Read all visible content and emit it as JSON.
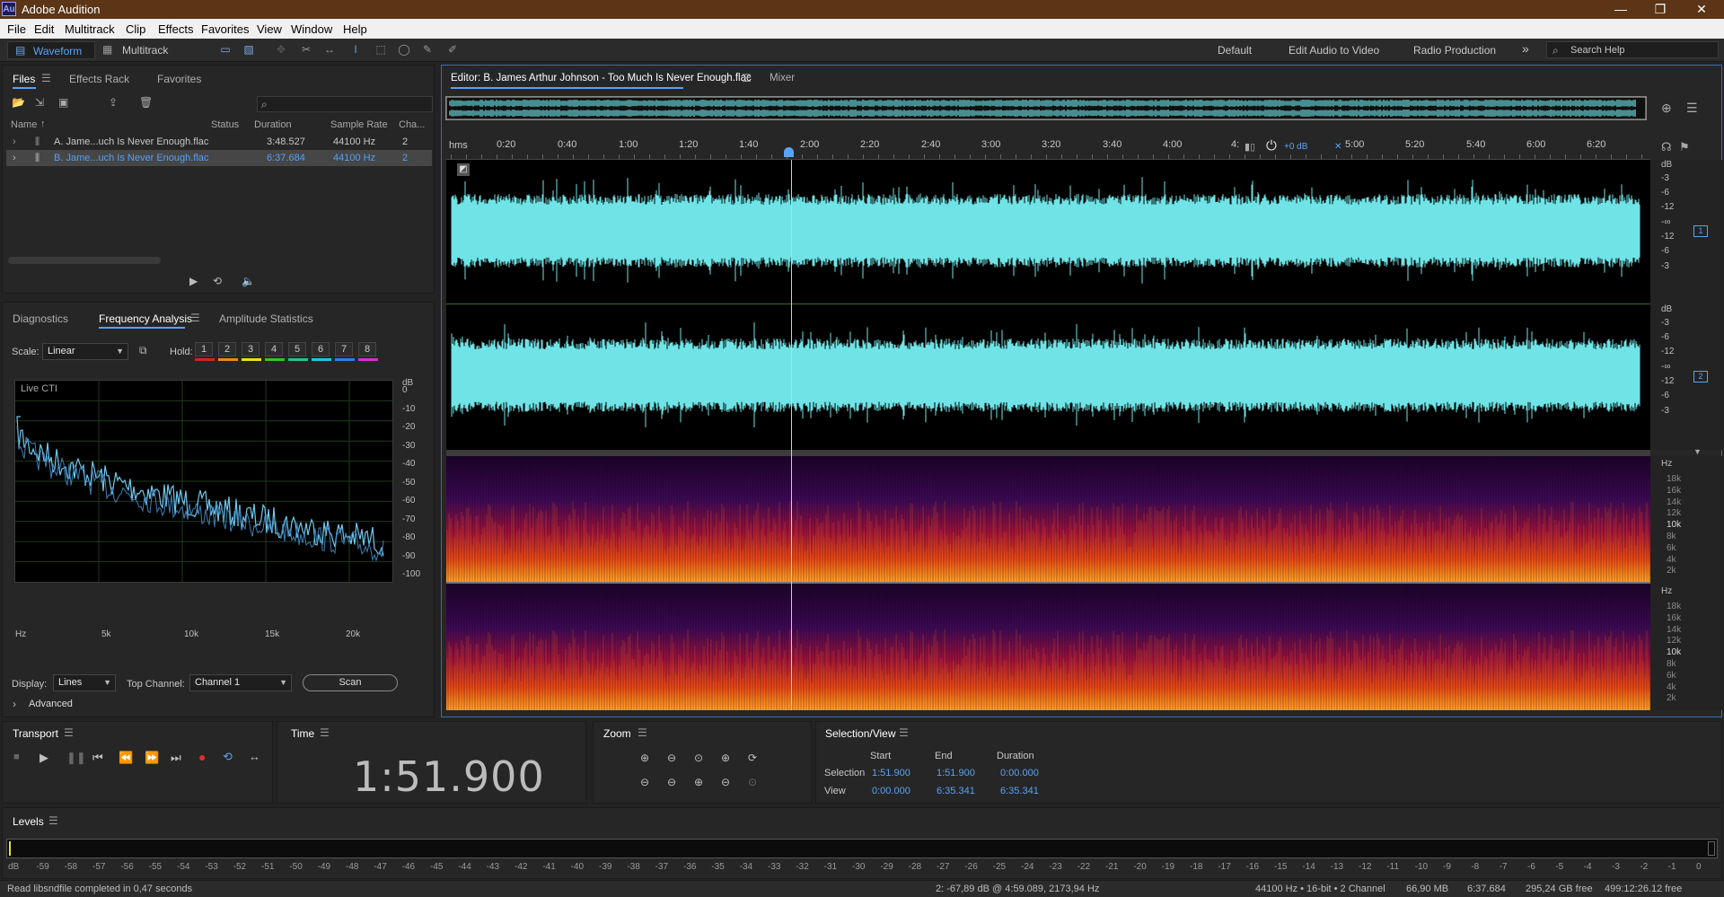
{
  "window": {
    "title": "Adobe Audition",
    "app_icon_text": "Au"
  },
  "menu": [
    "File",
    "Edit",
    "Multitrack",
    "Clip",
    "Effects",
    "Favorites",
    "View",
    "Window",
    "Help"
  ],
  "toolbar": {
    "waveform_label": "Waveform",
    "multitrack_label": "Multitrack",
    "workspaces": [
      "Default",
      "Edit Audio to Video",
      "Radio Production"
    ],
    "more_label": "»",
    "search_placeholder": "Search Help"
  },
  "files_panel": {
    "tabs": [
      "Files",
      "Effects Rack",
      "Favorites"
    ],
    "columns": [
      "Name",
      "Status",
      "Duration",
      "Sample Rate",
      "Cha..."
    ],
    "rows": [
      {
        "name": "A. Jame...uch Is Never Enough.flac",
        "status": "",
        "duration": "3:48.527",
        "sample_rate": "44100 Hz",
        "channels": "2",
        "selected": false
      },
      {
        "name": "B. Jame...uch Is Never Enough.flac",
        "status": "",
        "duration": "6:37.684",
        "sample_rate": "44100 Hz",
        "channels": "2",
        "selected": true
      }
    ]
  },
  "freq_panel": {
    "tabs": [
      "Diagnostics",
      "Frequency Analysis",
      "Amplitude Statistics"
    ],
    "scale_label": "Scale:",
    "scale_value": "Linear",
    "hold_label": "Hold:",
    "hold_buttons": [
      "1",
      "2",
      "3",
      "4",
      "5",
      "6",
      "7",
      "8"
    ],
    "hold_colors": [
      "#d42323",
      "#e88a1a",
      "#e8e21a",
      "#36c22f",
      "#2fbf8d",
      "#1ac5e8",
      "#2f7de8",
      "#d22fd0"
    ],
    "graph_title": "Live CTI",
    "db_unit": "dB",
    "db_ticks": [
      "0",
      "-10",
      "-20",
      "-30",
      "-40",
      "-50",
      "-60",
      "-70",
      "-80",
      "-90",
      "-100"
    ],
    "freq_ticks": [
      "Hz",
      "5k",
      "10k",
      "15k",
      "20k"
    ],
    "display_label": "Display:",
    "display_value": "Lines",
    "top_channel_label": "Top Channel:",
    "top_channel_value": "Channel 1",
    "scan_label": "Scan",
    "advanced_label": "Advanced"
  },
  "editor": {
    "tab_title": "Editor: B. James Arthur Johnson - Too Much Is Never Enough.flac",
    "mixer_tab": "Mixer",
    "timeline_unit": "hms",
    "timeline_ticks": [
      "0:20",
      "0:40",
      "1:00",
      "1:20",
      "1:40",
      "2:00",
      "2:20",
      "2:40",
      "3:00",
      "3:20",
      "3:40",
      "4:00",
      "4:",
      "5:00",
      "5:20",
      "5:40",
      "6:00",
      "6:20"
    ],
    "gain_label": "+0 dB",
    "db_ticks_ch": [
      "dB",
      "-3",
      "-6",
      "-12",
      "-∞",
      "-12",
      "-6",
      "-3"
    ],
    "channel_badges": [
      "1",
      "2"
    ],
    "hz_unit": "Hz",
    "hz_ticks": [
      "18k",
      "16k",
      "14k",
      "12k",
      "10k",
      "8k",
      "6k",
      "4k",
      "2k"
    ],
    "playhead_fraction": 0.2865
  },
  "transport": {
    "title": "Transport"
  },
  "time_panel": {
    "title": "Time",
    "value": "1:51.900"
  },
  "zoom_panel": {
    "title": "Zoom"
  },
  "selection_view": {
    "title": "Selection/View",
    "headers": [
      "Start",
      "End",
      "Duration"
    ],
    "rows": [
      {
        "label": "Selection",
        "start": "1:51.900",
        "end": "1:51.900",
        "duration": "0:00.000"
      },
      {
        "label": "View",
        "start": "0:00.000",
        "end": "6:35.341",
        "duration": "6:35.341"
      }
    ]
  },
  "levels": {
    "title": "Levels",
    "ticks": [
      "dB",
      "-59",
      "-58",
      "-57",
      "-56",
      "-55",
      "-54",
      "-53",
      "-52",
      "-51",
      "-50",
      "-49",
      "-48",
      "-47",
      "-46",
      "-45",
      "-44",
      "-43",
      "-42",
      "-41",
      "-40",
      "-39",
      "-38",
      "-37",
      "-36",
      "-35",
      "-34",
      "-33",
      "-32",
      "-31",
      "-30",
      "-29",
      "-28",
      "-27",
      "-26",
      "-25",
      "-24",
      "-23",
      "-22",
      "-21",
      "-20",
      "-19",
      "-18",
      "-17",
      "-16",
      "-15",
      "-14",
      "-13",
      "-12",
      "-11",
      "-10",
      "-9",
      "-8",
      "-7",
      "-6",
      "-5",
      "-4",
      "-3",
      "-2",
      "-1",
      "0"
    ]
  },
  "status": {
    "left": "Read libsndfile completed in 0,47 seconds",
    "cursor": "2: -67,89 dB @ 4:59.089, 2173,94 Hz",
    "format": "44100 Hz • 16-bit • 2 Channel",
    "size": "66,90 MB",
    "duration": "6:37.684",
    "free": "295,24 GB free",
    "time_free": "499:12:26.12 free"
  },
  "colors": {
    "waveform": "#6fe3e6",
    "accent": "#5aa2f5",
    "title_bar": "#5b3516",
    "playhead": "#e8e040"
  }
}
